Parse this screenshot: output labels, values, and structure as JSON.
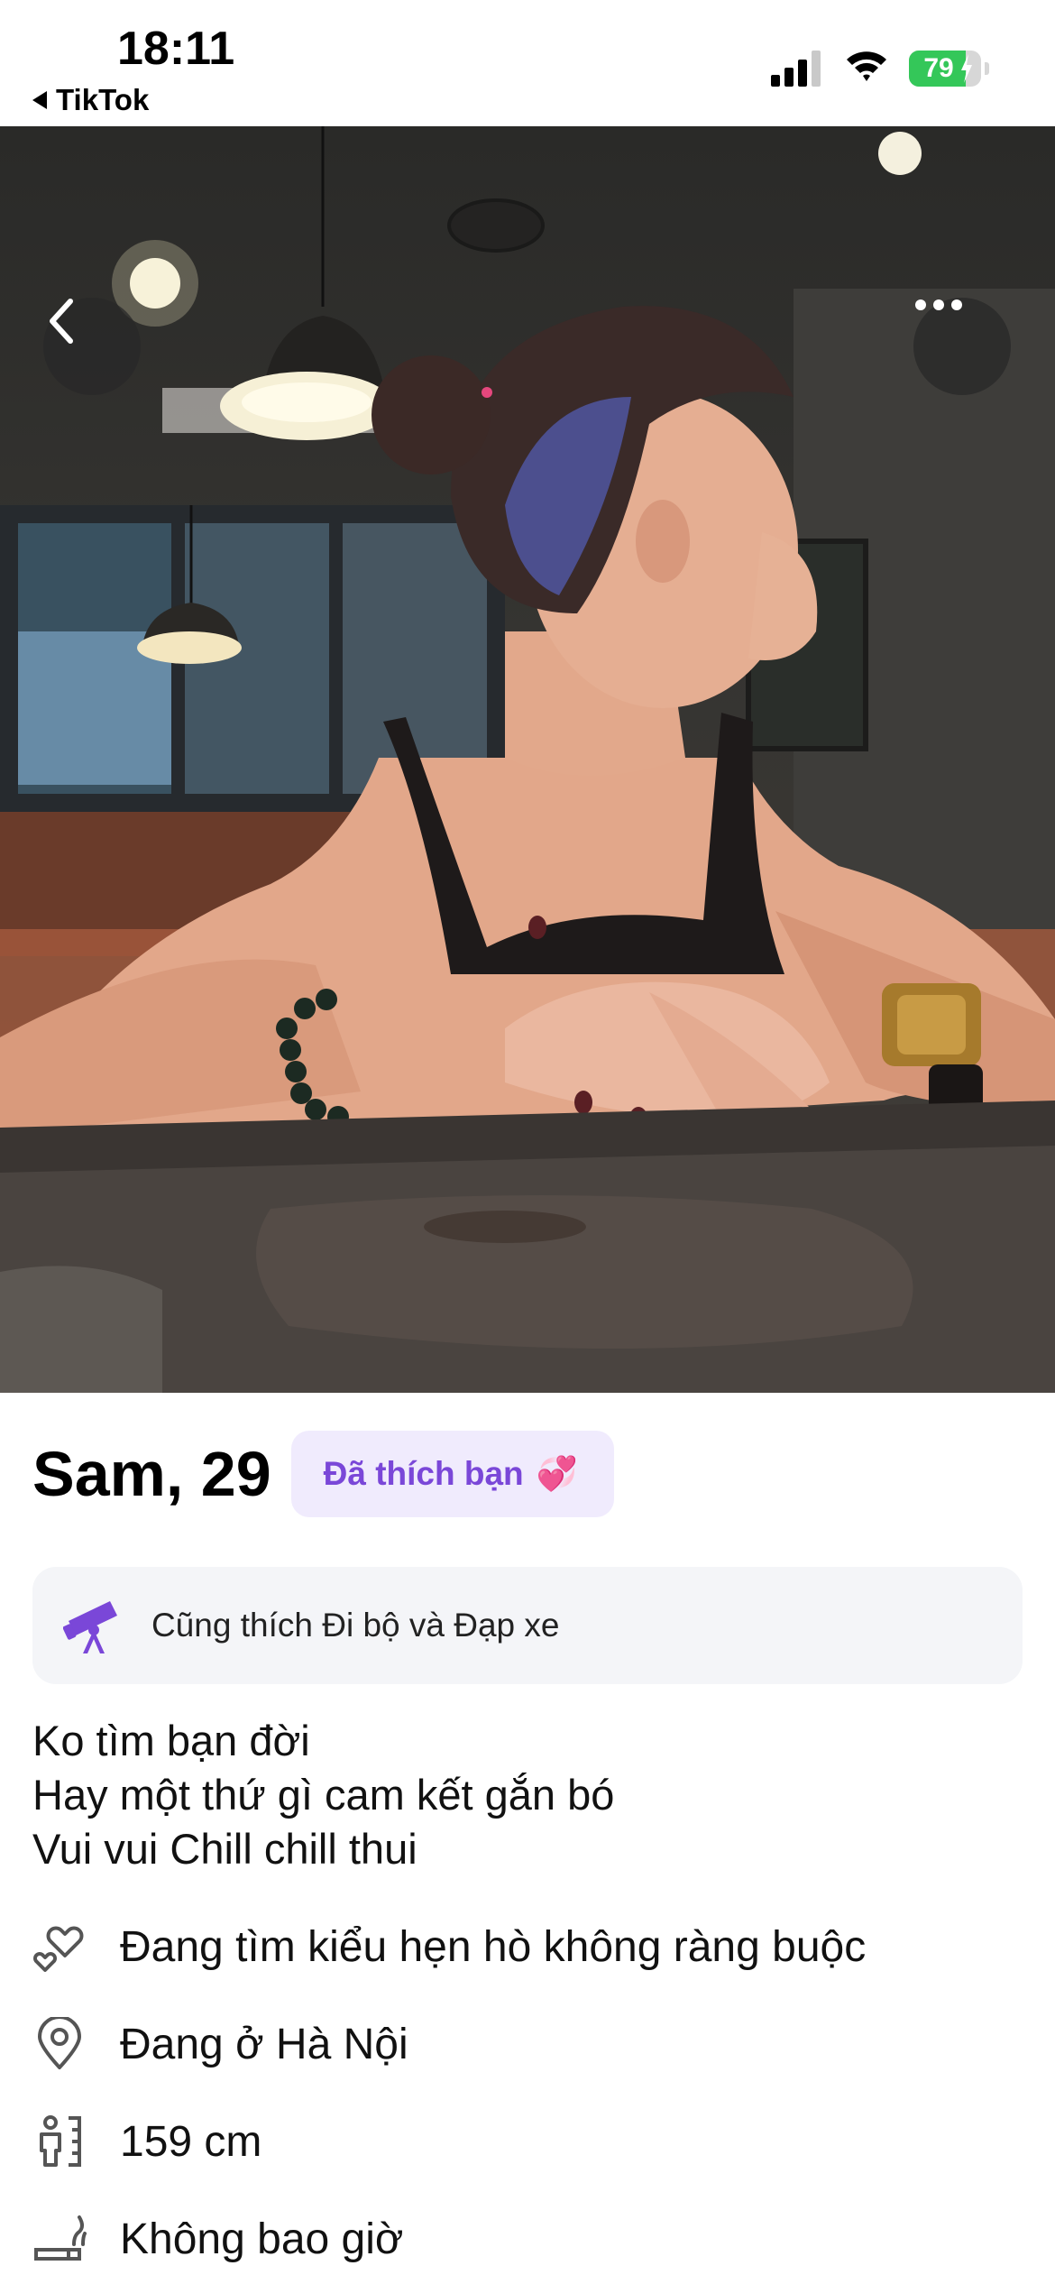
{
  "status_bar": {
    "time": "18:11",
    "back_app": "TikTok",
    "battery_level": 79,
    "battery_text": "79",
    "battery_color": "#34c759"
  },
  "photo": {
    "back_icon": "chevron-left-icon",
    "more_icon": "more-horizontal-icon"
  },
  "profile": {
    "name_age": "Sam, 29",
    "liked_badge": "Đã thích bạn",
    "liked_badge_icon": "💞",
    "accent_color": "#7a47d8",
    "shared_interest": "Cũng thích Đi bộ và Đạp xe",
    "bio_lines": [
      "Ko tìm bạn đời",
      "Hay một thứ gì cam kết gắn bó",
      "Vui vui Chill chill thui"
    ],
    "details": [
      {
        "icon": "hearts-icon",
        "text": "Đang tìm kiểu hẹn hò không ràng buộc"
      },
      {
        "icon": "location-pin-icon",
        "text": "Đang ở Hà Nội"
      },
      {
        "icon": "height-icon",
        "text": "159 cm"
      },
      {
        "icon": "smoking-icon",
        "text": "Không bao giờ"
      }
    ]
  }
}
